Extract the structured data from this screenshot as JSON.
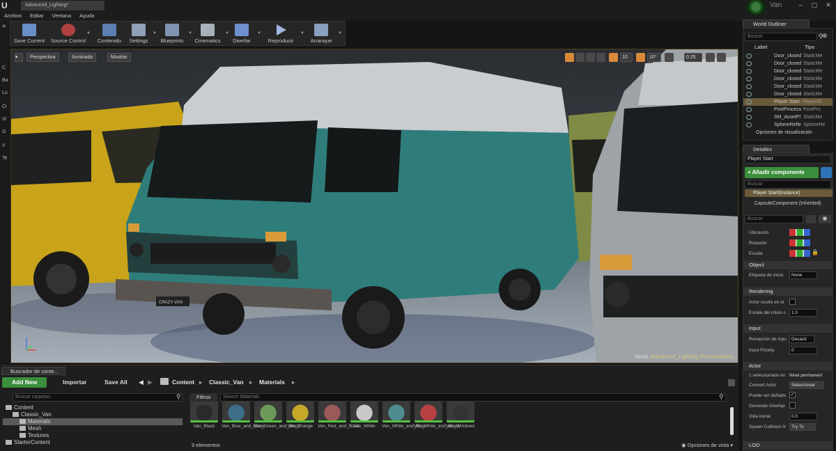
{
  "app": {
    "document_tab": "Advanced_Lighting*",
    "menu": [
      "Archivo",
      "Editar",
      "Ventana",
      "Ayuda"
    ],
    "user": "Van"
  },
  "toolbar": [
    {
      "label": "Save Current",
      "icon": "save-icon",
      "color": "#6a8fc8"
    },
    {
      "label": "Source Control",
      "icon": "source-control-icon",
      "color": "#b04040"
    },
    {
      "label": "Contenido",
      "icon": "content-icon",
      "color": "#5b7fb0"
    },
    {
      "label": "Settings",
      "icon": "settings-icon",
      "color": "#8fa0b8"
    },
    {
      "label": "Blueprints",
      "icon": "blueprints-icon",
      "color": "#7f93b3"
    },
    {
      "label": "Cinematics",
      "icon": "cinematics-icon",
      "color": "#a8b0bc"
    },
    {
      "label": "Diseñar",
      "icon": "design-icon",
      "color": "#6d8fcf"
    },
    {
      "label": "Reproducir",
      "icon": "play-icon",
      "color": "#9fb6e0"
    },
    {
      "label": "Arranque",
      "icon": "launch-icon",
      "color": "#8aa0c0"
    }
  ],
  "left_strip": [
    "C",
    "Ba",
    "Lu",
    "Ci",
    "Vi",
    "G",
    "V",
    "Te"
  ],
  "viewport": {
    "perspective_label": "Perspectiva",
    "lit_label": "Iluminado",
    "show_label": "Mostrar",
    "grid_value": "10",
    "rotation_value": "10°",
    "camera_speed": "0.25",
    "level_prefix": "Nivel:",
    "level_name": "Advanced_Lighting (Permanente)",
    "plate_text": "CRAZY VAN"
  },
  "outliner": {
    "tab": "World Outliner",
    "search_placeholder": "Buscar",
    "col_label": "Label",
    "col_type": "Tipo",
    "rows": [
      {
        "label": "Door_closed",
        "type": "StaticMe",
        "selected": false
      },
      {
        "label": "Door_closed",
        "type": "StaticMe",
        "selected": false
      },
      {
        "label": "Door_closed",
        "type": "StaticMe",
        "selected": false
      },
      {
        "label": "Door_closed",
        "type": "StaticMe",
        "selected": false
      },
      {
        "label": "Door_closed",
        "type": "StaticMe",
        "selected": false
      },
      {
        "label": "Door_closed",
        "type": "StaticMe",
        "selected": false
      },
      {
        "label": "Player Start",
        "type": "PlayerSt",
        "selected": true
      },
      {
        "label": "PostProcess",
        "type": "PostPro",
        "selected": false
      },
      {
        "label": "SM_AssetPl",
        "type": "StaticMe",
        "selected": false
      },
      {
        "label": "SphereRefle",
        "type": "SphereRe",
        "selected": false
      }
    ],
    "view_options": "Opciones de visualización"
  },
  "details": {
    "tab": "Detalles",
    "name_value": "Player Start",
    "add_component": "+ Añadir componente",
    "search_placeholder": "Buscar",
    "instance_item": "Player Start(Instance)",
    "component_item": "CapsuleComponent (Inherited)",
    "search2_placeholder": "Buscar",
    "transform": [
      "Ubicación",
      "Rotación",
      "Escala"
    ],
    "sections": {
      "object": "Object",
      "rendering": "Rendering",
      "input": "Input",
      "actor": "Actor",
      "lod": "LOD"
    },
    "props": {
      "tag_label": "Etiqueta de inicio",
      "tag_value": "None",
      "hidden_label": "Actor oculto en el",
      "scale_label": "Escala del rótulo c",
      "scale_value": "1.0",
      "input_recv_label": "Recepción de inpu",
      "input_recv_value": "Desacti",
      "input_prio_label": "Input Priority",
      "input_prio_value": "0",
      "selected_label": "1 seleccionado en",
      "selected_value": "Nivel permanent",
      "convert_label": "Convert Actor",
      "convert_value": "Seleccionar",
      "damage_label": "Puede ser dañado",
      "overlap_label": "Generate Overlap",
      "life_label": "Vida inicial",
      "life_value": "0.0",
      "spawn_label": "Spawn Collision H",
      "spawn_value": "Try To"
    }
  },
  "content_browser": {
    "tab": "Buscador de conte...",
    "add_new": "Add New",
    "import": "Importar",
    "save_all": "Save All",
    "breadcrumbs": [
      "Content",
      "Classic_Van",
      "Materials"
    ],
    "folder_search_placeholder": "Buscar carpetas",
    "filters": "Filtros",
    "asset_search_placeholder": "Search Materials",
    "folders": [
      {
        "name": "Content",
        "indent": 0,
        "selected": false
      },
      {
        "name": "Classic_Van",
        "indent": 1,
        "selected": false
      },
      {
        "name": "Materials",
        "indent": 2,
        "selected": true
      },
      {
        "name": "Mesh",
        "indent": 2,
        "selected": false
      },
      {
        "name": "Textures",
        "indent": 2,
        "selected": false
      },
      {
        "name": "StarterContent",
        "indent": 0,
        "selected": false
      }
    ],
    "assets": [
      {
        "name": "Van_Black",
        "color": "#2a2a2a"
      },
      {
        "name": "Van_Blue_and_Black",
        "color": "#3d6f8a"
      },
      {
        "name": "Van_Green_and_Black",
        "color": "#6d9a5a"
      },
      {
        "name": "Van_Orange",
        "color": "#c7a92a"
      },
      {
        "name": "Van_Red_and_Black",
        "color": "#9b5a5a"
      },
      {
        "name": "Van_White",
        "color": "#c8c8c8"
      },
      {
        "name": "Van_White_and_Blue",
        "color": "#4e8c90"
      },
      {
        "name": "Van_White_and_Blue1",
        "color": "#b84040"
      },
      {
        "name": "Van_Windows",
        "color": "#333333"
      }
    ],
    "count": "9 elementos",
    "view_options": "Opciones de vista"
  }
}
